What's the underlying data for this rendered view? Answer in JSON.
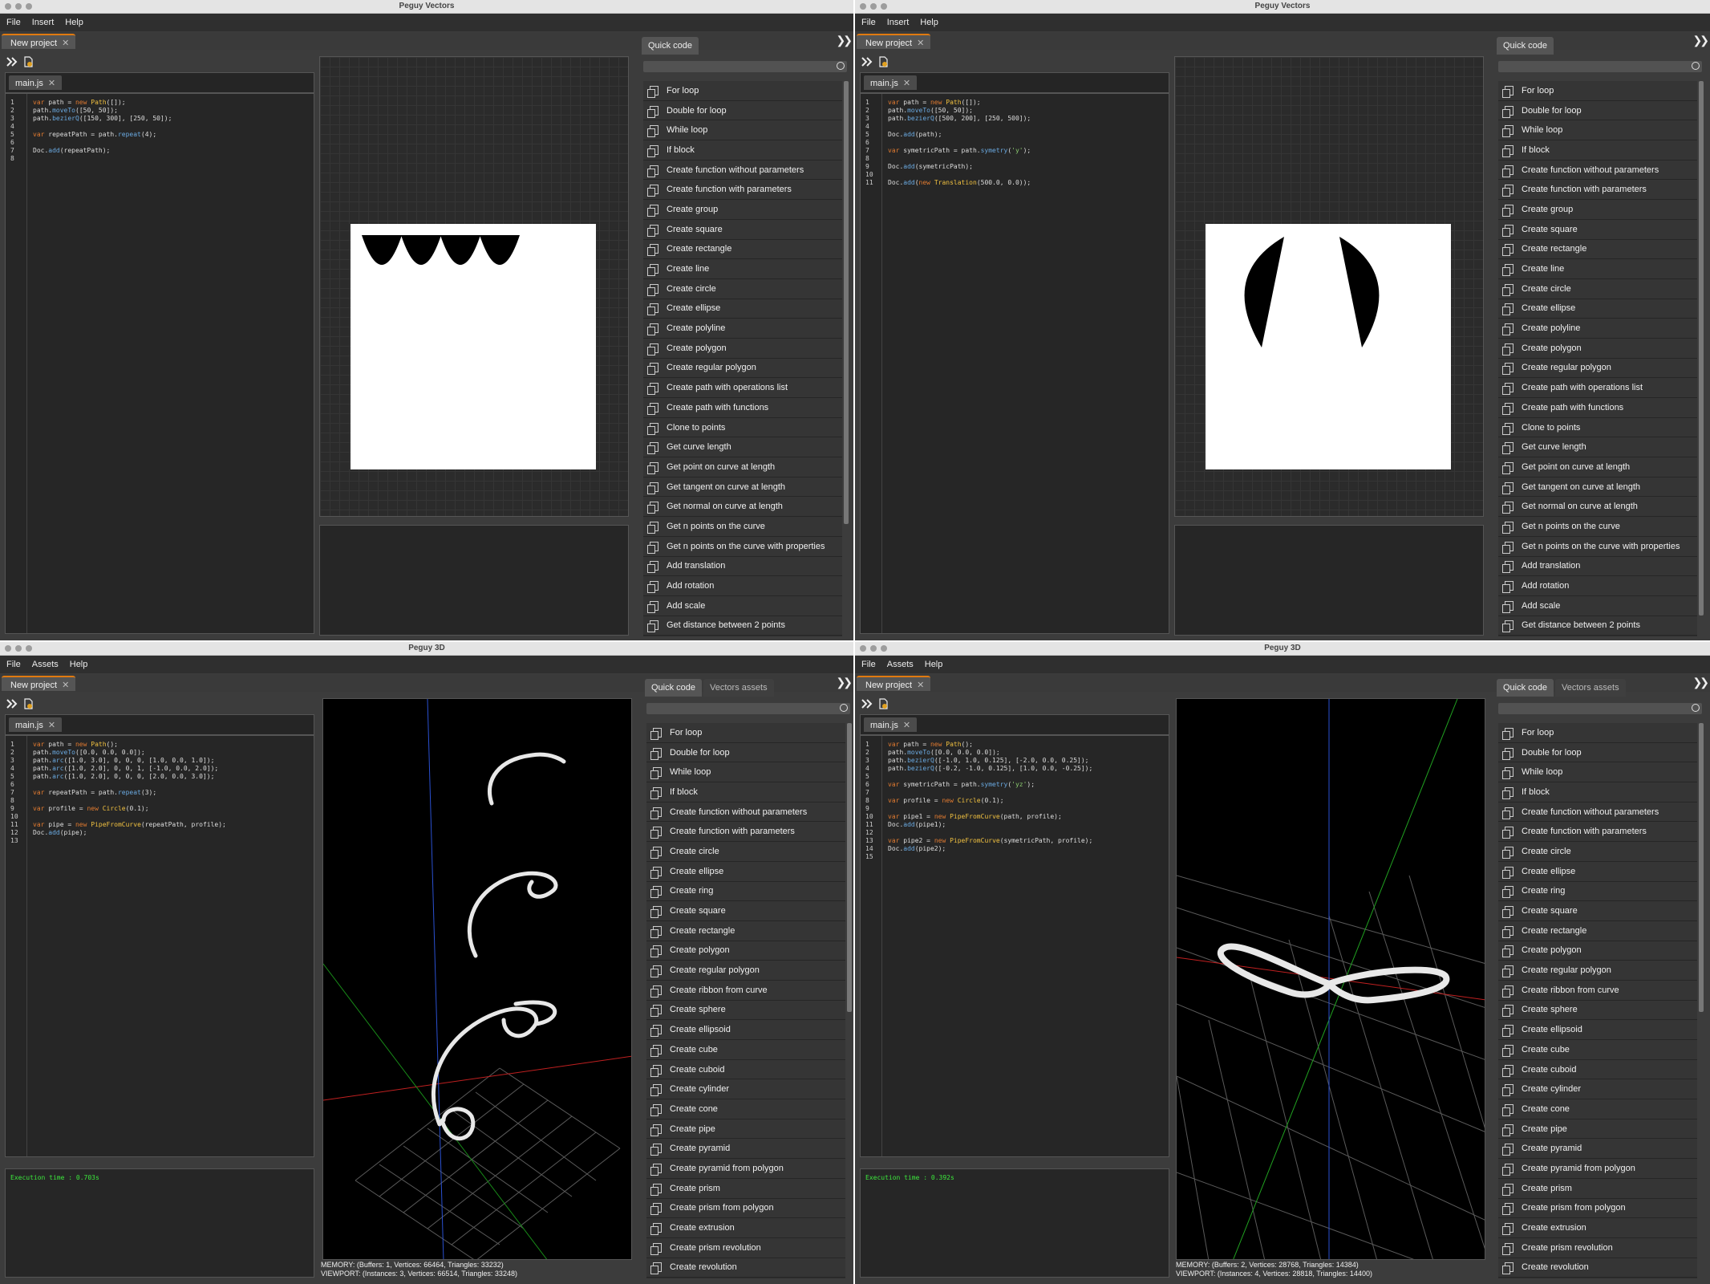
{
  "windows": [
    {
      "title": "Peguy Vectors",
      "menu": [
        "File",
        "Insert",
        "Help"
      ],
      "project_tab": "New project",
      "editor_tab": "main.js",
      "code": [
        "var path = new Path([]);",
        "path.moveTo([50, 50]);",
        "path.bezierQ([150, 300], [250, 50]);",
        "",
        "var repeatPath = path.repeat(4);",
        "",
        "Doc.add(repeatPath);",
        ""
      ],
      "console": "",
      "quick_tabs": [
        "Quick code"
      ],
      "quick_items": [
        "For loop",
        "Double for loop",
        "While loop",
        "If block",
        "Create function without parameters",
        "Create function with parameters",
        "Create group",
        "Create square",
        "Create rectangle",
        "Create line",
        "Create circle",
        "Create ellipse",
        "Create polyline",
        "Create polygon",
        "Create regular polygon",
        "Create path with operations list",
        "Create path with functions",
        "Clone to points",
        "Get curve length",
        "Get point on curve at length",
        "Get tangent on curve at length",
        "Get normal on curve at length",
        "Get n points on the curve",
        "Get n points on the curve with properties",
        "Add translation",
        "Add rotation",
        "Add scale",
        "Get distance between 2 points"
      ]
    },
    {
      "title": "Peguy Vectors",
      "menu": [
        "File",
        "Insert",
        "Help"
      ],
      "project_tab": "New project",
      "editor_tab": "main.js",
      "code": [
        "var path = new Path([]);",
        "path.moveTo([50, 50]);",
        "path.bezierQ([500, 200], [250, 500]);",
        "",
        "Doc.add(path);",
        "",
        "var symetricPath = path.symetry('y');",
        "",
        "Doc.add(symetricPath);",
        "",
        "Doc.add(new Translation(500.0, 0.0));"
      ],
      "console": "",
      "quick_tabs": [
        "Quick code"
      ],
      "quick_items": [
        "For loop",
        "Double for loop",
        "While loop",
        "If block",
        "Create function without parameters",
        "Create function with parameters",
        "Create group",
        "Create square",
        "Create rectangle",
        "Create line",
        "Create circle",
        "Create ellipse",
        "Create polyline",
        "Create polygon",
        "Create regular polygon",
        "Create path with operations list",
        "Create path with functions",
        "Clone to points",
        "Get curve length",
        "Get point on curve at length",
        "Get tangent on curve at length",
        "Get normal on curve at length",
        "Get n points on the curve",
        "Get n points on the curve with properties",
        "Add translation",
        "Add rotation",
        "Add scale",
        "Get distance between 2 points"
      ]
    },
    {
      "title": "Peguy 3D",
      "menu": [
        "File",
        "Assets",
        "Help"
      ],
      "project_tab": "New project",
      "editor_tab": "main.js",
      "code": [
        "var path = new Path();",
        "path.moveTo([0.0, 0.0, 0.0]);",
        "path.arc([1.0, 3.0], 0, 0, 0, [1.0, 0.0, 1.0]);",
        "path.arc([1.0, 2.0], 0, 0, 1, [-1.0, 0.0, 2.0]);",
        "path.arc([1.0, 2.0], 0, 0, 0, [2.0, 0.0, 3.0]);",
        "",
        "var repeatPath = path.repeat(3);",
        "",
        "var profile = new Circle(0.1);",
        "",
        "var pipe = new PipeFromCurve(repeatPath, profile);",
        "Doc.add(pipe);",
        ""
      ],
      "console": "Execution time : 0.703s",
      "stats": [
        "MEMORY: (Buffers: 1, Vertices: 66464, Triangles: 33232)",
        "VIEWPORT: (Instances: 3, Vertices: 66514, Triangles: 33248)"
      ],
      "quick_tabs": [
        "Quick code",
        "Vectors assets"
      ],
      "quick_items": [
        "For loop",
        "Double for loop",
        "While loop",
        "If block",
        "Create function without parameters",
        "Create function with parameters",
        "Create circle",
        "Create ellipse",
        "Create ring",
        "Create square",
        "Create rectangle",
        "Create polygon",
        "Create regular polygon",
        "Create ribbon from curve",
        "Create sphere",
        "Create ellipsoid",
        "Create cube",
        "Create cuboid",
        "Create cylinder",
        "Create cone",
        "Create pipe",
        "Create pyramid",
        "Create pyramid from polygon",
        "Create prism",
        "Create prism from polygon",
        "Create extrusion",
        "Create prism revolution",
        "Create revolution"
      ]
    },
    {
      "title": "Peguy 3D",
      "menu": [
        "File",
        "Assets",
        "Help"
      ],
      "project_tab": "New project",
      "editor_tab": "main.js",
      "code": [
        "var path = new Path();",
        "path.moveTo([0.0, 0.0, 0.0]);",
        "path.bezierQ([-1.0, 1.0, 0.125], [-2.0, 0.0, 0.25]);",
        "path.bezierQ([-0.2, -1.0, 0.125], [1.0, 0.0, -0.25]);",
        "",
        "var symetricPath = path.symetry('yz');",
        "",
        "var profile = new Circle(0.1);",
        "",
        "var pipe1 = new PipeFromCurve(path, profile);",
        "Doc.add(pipe1);",
        "",
        "var pipe2 = new PipeFromCurve(symetricPath, profile);",
        "Doc.add(pipe2);",
        ""
      ],
      "console": "Execution time : 0.392s",
      "stats": [
        "MEMORY: (Buffers: 2, Vertices: 28768, Triangles: 14384)",
        "VIEWPORT: (Instances: 4, Vertices: 28818, Triangles: 14400)"
      ],
      "quick_tabs": [
        "Quick code",
        "Vectors assets"
      ],
      "quick_items": [
        "For loop",
        "Double for loop",
        "While loop",
        "If block",
        "Create function without parameters",
        "Create function with parameters",
        "Create circle",
        "Create ellipse",
        "Create ring",
        "Create square",
        "Create rectangle",
        "Create polygon",
        "Create regular polygon",
        "Create ribbon from curve",
        "Create sphere",
        "Create ellipsoid",
        "Create cube",
        "Create cuboid",
        "Create cylinder",
        "Create cone",
        "Create pipe",
        "Create pyramid",
        "Create pyramid from polygon",
        "Create prism",
        "Create prism from polygon",
        "Create extrusion",
        "Create prism revolution",
        "Create revolution"
      ]
    }
  ],
  "colors": {
    "accent": "#e07a10",
    "console_text": "#3ce83c",
    "axis_x": "#d02020",
    "axis_y": "#20c020",
    "axis_z": "#2050e0"
  }
}
